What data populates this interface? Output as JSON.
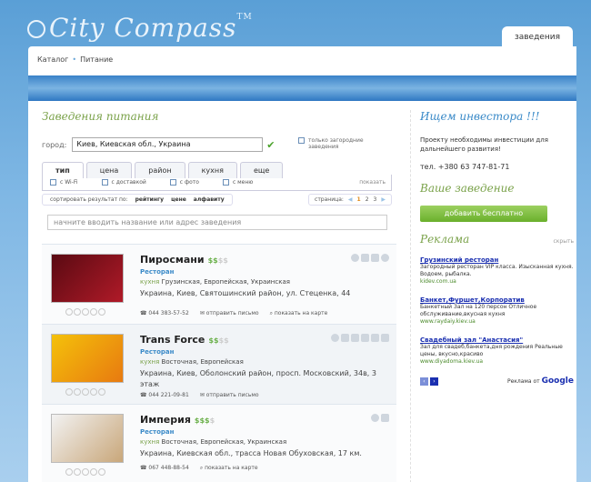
{
  "header": {
    "logo_text": "City Compass",
    "logo_tm": "TM",
    "top_tab": "заведения"
  },
  "breadcrumb": {
    "item1": "Каталог",
    "item2": "Питание"
  },
  "left": {
    "title": "Заведения питания",
    "city_label": "город:",
    "city_value": "Киев, Киевская обл., Украина",
    "only_country": "только загородние заведения",
    "tabs": [
      "тип",
      "цена",
      "район",
      "кухня",
      "еще"
    ],
    "filters": [
      "с Wi-Fi",
      "с доставкой",
      "с фото",
      "с меню"
    ],
    "show_label": "показать",
    "sort_label": "сортировать результат по:",
    "sort_options": [
      "рейтингу",
      "цене",
      "алфавиту"
    ],
    "page_label": "страница:",
    "pages": [
      "1",
      "2",
      "3"
    ],
    "search_placeholder": "начните вводить название или адрес заведения"
  },
  "listings": [
    {
      "name": "Пиросмани",
      "price_on": "$$",
      "price_off": "$$",
      "category": "Ресторан",
      "cuisine_label": "кухня",
      "cuisine": "Грузинская, Европейская, Украинская",
      "address": "Украина, Киев, Святошинский район, ул. Стеценка, 44",
      "phone": "044 383-57-52",
      "send": "отправить письмо",
      "map": "показать на карте"
    },
    {
      "name": "Trans Force",
      "price_on": "$$",
      "price_off": "$$",
      "category": "Ресторан",
      "cuisine_label": "кухня",
      "cuisine": "Восточная, Европейская",
      "address": "Украина, Киев, Оболонский район, просп. Московский, 34в, 3 этаж",
      "phone": "044 221-09-81",
      "send": "отправить письмо"
    },
    {
      "name": "Империя",
      "price_on": "$$$",
      "price_off": "$",
      "category": "Ресторан",
      "cuisine_label": "кухня",
      "cuisine": "Восточная, Европейская, Украинская",
      "address": "Украина, Киевская обл., трасса Новая Обуховская, 17 км.",
      "phone": "067 448-88-54",
      "map": "показать на карте"
    }
  ],
  "right": {
    "investor_title": "Ищем инвестора !!!",
    "investor_text": "Проекту необходимы инвестиции для дальнейшего развития!",
    "phone": "тел. +380 63 747-81-71",
    "your_title": "Ваше заведение",
    "add_button": "добавить бесплатно",
    "ads_title": "Реклама",
    "ads_hide": "скрыть",
    "ads": [
      {
        "title": "Грузинский ресторан",
        "text": "Загородный ресторан VIP класса. Изысканная кухня. Водоем, рыбалка.",
        "url": "kidev.com.ua"
      },
      {
        "title": "Банкет,Фуршет,Корпоратив",
        "text": "Банкетный Зал на 120 персон Отличное обслуживание,вкусная кухня",
        "url": "www.raydaiy.kiev.ua"
      },
      {
        "title": "Свадебный зал \"Анастасия\"",
        "text": "Зал для свадеб,банкета,дня рождения Реальные цены, вкусно,красиво",
        "url": "www.diyadoma.kiev.ua"
      }
    ],
    "ads_by": "Реклама от",
    "google": "Google"
  }
}
